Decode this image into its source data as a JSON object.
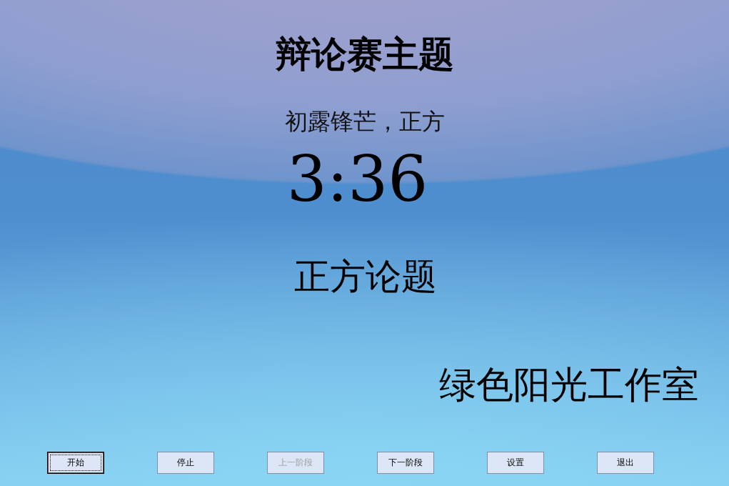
{
  "title": "辩论赛主题",
  "stage": "初露锋芒，正方",
  "timer": "3:36",
  "topic": "正方论题",
  "studio": "绿色阳光工作室",
  "buttons": [
    {
      "label": "开始",
      "focused": true,
      "disabled": false
    },
    {
      "label": "停止",
      "focused": false,
      "disabled": false
    },
    {
      "label": "上一阶段",
      "focused": false,
      "disabled": true
    },
    {
      "label": "下一阶段",
      "focused": false,
      "disabled": false
    },
    {
      "label": "设置",
      "focused": false,
      "disabled": false
    },
    {
      "label": "退出",
      "focused": false,
      "disabled": false
    }
  ]
}
